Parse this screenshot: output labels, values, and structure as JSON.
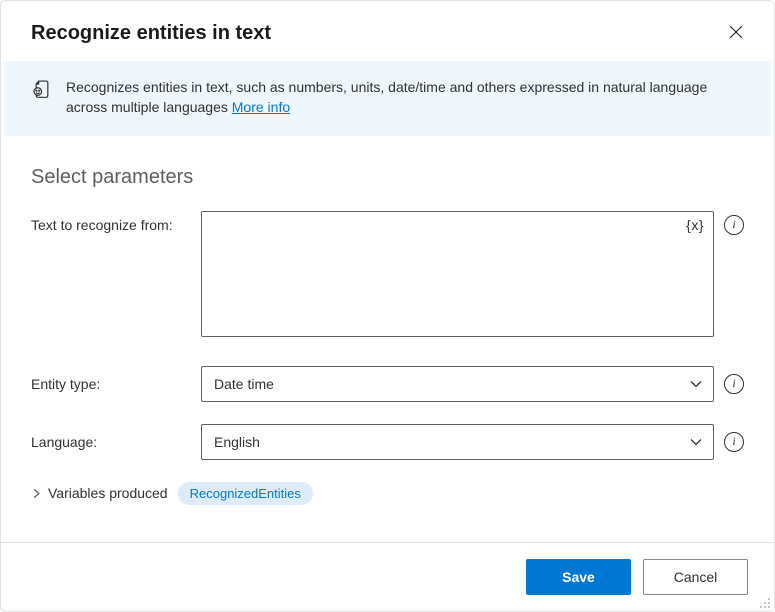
{
  "header": {
    "title": "Recognize entities in text"
  },
  "banner": {
    "description_prefix": "Recognizes entities in text, such as numbers, units, date/time and others expressed in natural language across multiple languages ",
    "more_info_label": "More info"
  },
  "section_title": "Select parameters",
  "params": {
    "text": {
      "label": "Text to recognize from:",
      "value": "",
      "var_insert_label": "{x}"
    },
    "entity_type": {
      "label": "Entity type:",
      "value": "Date time"
    },
    "language": {
      "label": "Language:",
      "value": "English"
    }
  },
  "variables": {
    "label": "Variables produced",
    "items": [
      "RecognizedEntities"
    ]
  },
  "footer": {
    "save_label": "Save",
    "cancel_label": "Cancel"
  },
  "icons": {
    "info_glyph": "i"
  }
}
